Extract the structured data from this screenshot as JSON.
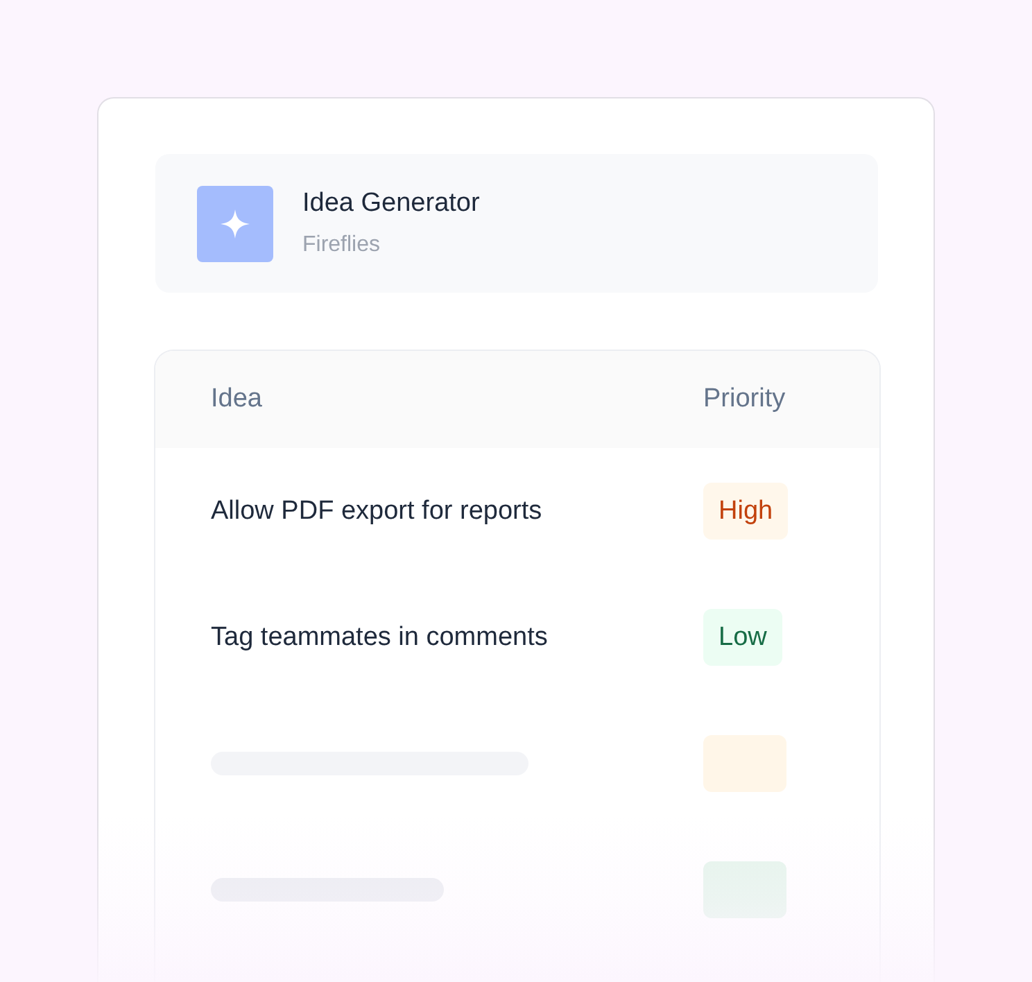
{
  "app": {
    "title": "Idea Generator",
    "subtitle": "Fireflies"
  },
  "table": {
    "columns": [
      "Idea",
      "Priority"
    ],
    "rows": [
      {
        "kind": "entry",
        "idea": "Allow PDF export for reports",
        "priority": {
          "kind": "high",
          "label": "High"
        }
      },
      {
        "kind": "entry",
        "idea": "Tag teammates in comments",
        "priority": {
          "kind": "low",
          "label": "Low"
        }
      },
      {
        "kind": "loading",
        "priority": {
          "kind": "high"
        }
      },
      {
        "kind": "loading",
        "priority": {
          "kind": "low"
        }
      }
    ]
  }
}
